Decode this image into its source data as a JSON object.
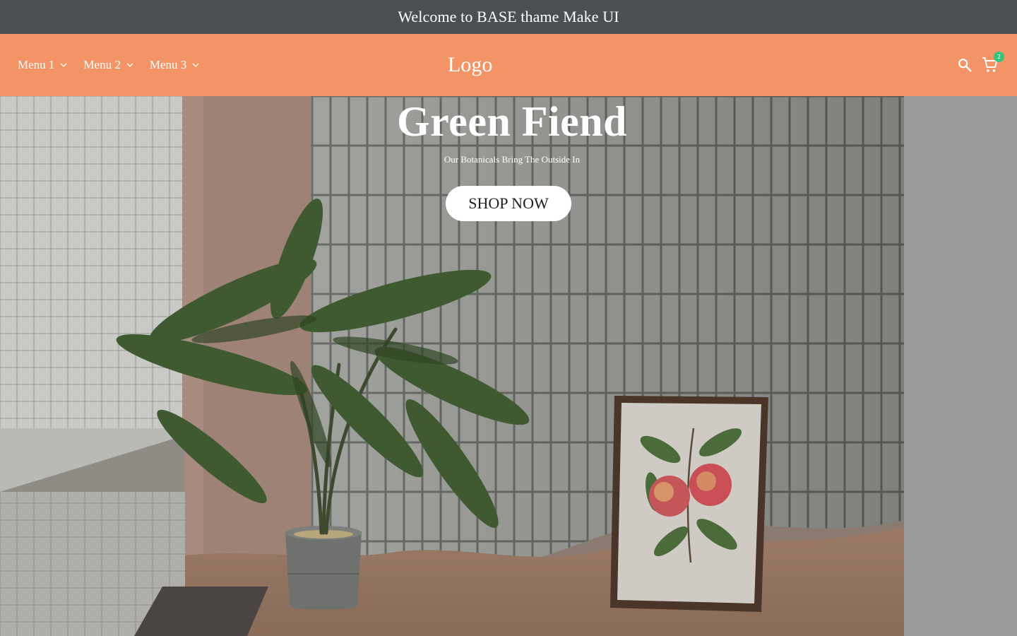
{
  "announcement": {
    "text": "Welcome to BASE thame Make UI"
  },
  "header": {
    "menu": [
      {
        "label": "Menu 1"
      },
      {
        "label": "Menu 2"
      },
      {
        "label": "Menu 3"
      }
    ],
    "logo": "Logo",
    "cart_count": "2",
    "icons": {
      "search": "search-icon",
      "cart": "cart-icon",
      "chevron": "chevron-down-icon"
    }
  },
  "hero": {
    "title": "Green Fiend",
    "subtitle": "Our Botanicals Bring The Outside In",
    "cta": "SHOP NOW"
  },
  "colors": {
    "announcement_bg": "#4a4f52",
    "header_bg": "#f29466",
    "badge": "#35c27a",
    "side_panel": "#9b9b9b"
  }
}
